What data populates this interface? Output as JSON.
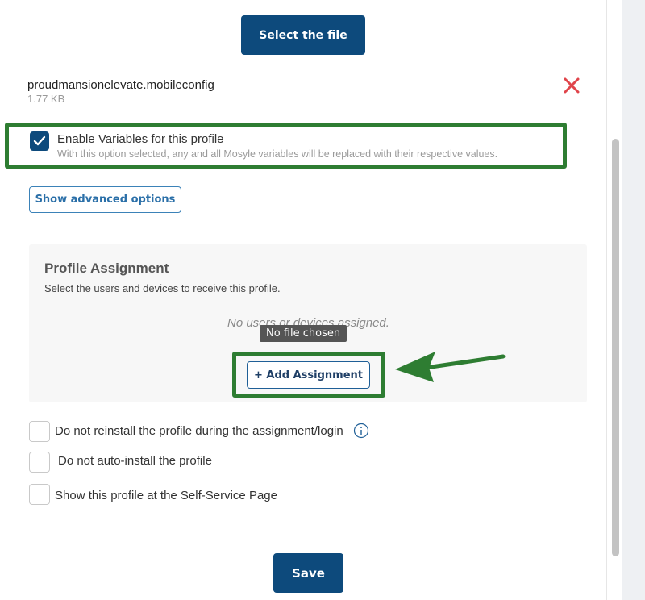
{
  "upload": {
    "select_label": "Select the file"
  },
  "file": {
    "name": "proudmansionelevate.mobileconfig",
    "size": "1.77 KB",
    "remove_icon": "close-icon"
  },
  "variables": {
    "checked": true,
    "label": "Enable Variables for this profile",
    "description": "With this option selected, any and all Mosyle variables will be replaced with their respective values."
  },
  "advanced": {
    "label": "Show advanced options"
  },
  "assignment": {
    "title": "Profile Assignment",
    "subtitle": "Select the users and devices to receive this profile.",
    "empty_text": "No users or devices assigned.",
    "tooltip": "No file chosen",
    "add_label": "+ Add Assignment"
  },
  "options": [
    {
      "label": "Do not reinstall the profile during the assignment/login",
      "checked": false,
      "info_icon": "info-icon"
    },
    {
      "label": "Do not auto-install the profile",
      "checked": false
    },
    {
      "label": "Show this profile at the Self-Service Page",
      "checked": false
    }
  ],
  "footer": {
    "save_label": "Save"
  },
  "colors": {
    "primary": "#0d4a7c",
    "highlight": "#2e7d32",
    "danger": "#e0454b"
  }
}
